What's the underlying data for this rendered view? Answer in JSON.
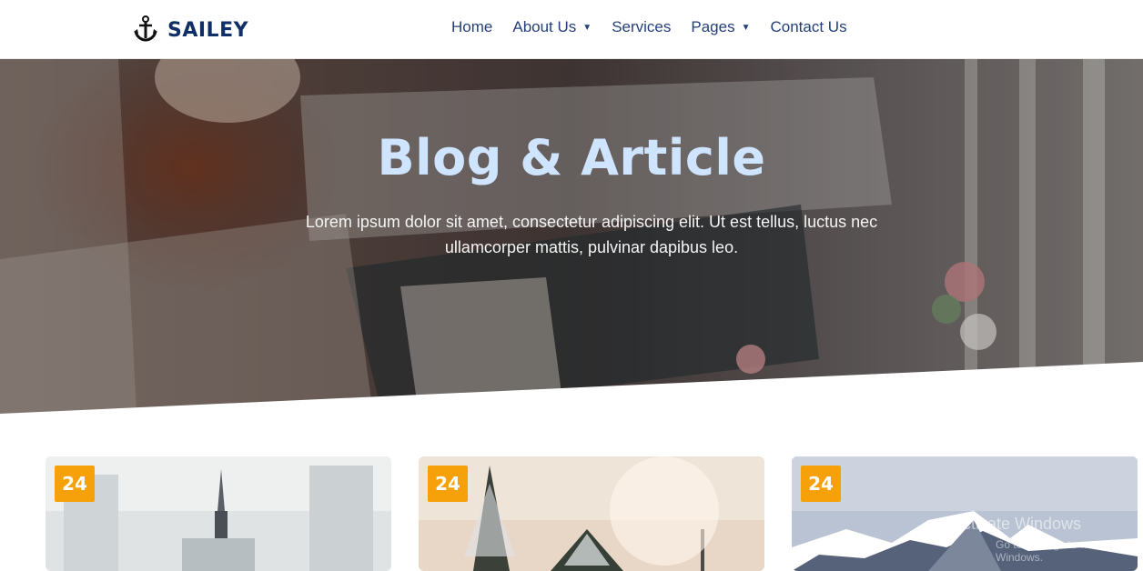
{
  "brand": {
    "name": "SAILEY",
    "logo_icon": "anchor-icon"
  },
  "nav": {
    "items": [
      {
        "label": "Home",
        "dropdown": false
      },
      {
        "label": "About Us",
        "dropdown": true
      },
      {
        "label": "Services",
        "dropdown": false
      },
      {
        "label": "Pages",
        "dropdown": true
      },
      {
        "label": "Contact Us",
        "dropdown": false
      }
    ]
  },
  "hero": {
    "title": "Blog & Article",
    "subtitle": "Lorem ipsum dolor sit amet, consectetur adipiscing elit. Ut est tellus, luctus nec ullamcorper mattis, pulvinar dapibus leo."
  },
  "posts": [
    {
      "date": "24"
    },
    {
      "date": "24"
    },
    {
      "date": "24"
    }
  ],
  "overlay": {
    "line1": "Activate Windows",
    "line2": "Go to Settings to activate Windows."
  },
  "colors": {
    "brand": "#0f2f66",
    "accent": "#f7a10a",
    "hero_title": "#cfe4ff"
  }
}
